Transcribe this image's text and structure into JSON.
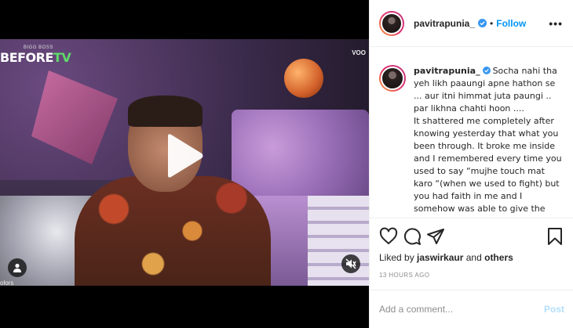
{
  "media": {
    "brand_small": "BIGG BOSS",
    "brand_before": "BEFORE",
    "brand_tv": "TV",
    "watermark_right": "VOO",
    "watermark_bottom": "olors"
  },
  "post_header": {
    "username": "pavitrapunia_",
    "separator": "•",
    "follow_label": "Follow",
    "more_label": "•••"
  },
  "caption": {
    "username": "pavitrapunia_",
    "lead": "Socha nahi tha yeh likh paaungi apne hathon se ... aur itni himmat juta paungi .. par likhna chahti hoon ....",
    "body": "It shattered me completely after knowing yesterday that what you been through. It broke me inside and I remembered every time you used to say “mujhe touch mat karo “(when we used to fight) but you had faith in me and I somehow was able to give the"
  },
  "likes": {
    "prefix": "Liked by ",
    "user": "jaswirkaur",
    "and": " and ",
    "others": "others"
  },
  "timestamp": "13 HOURS AGO",
  "comment": {
    "placeholder": "Add a comment...",
    "value": "",
    "post_label": "Post"
  },
  "colors": {
    "accent": "#0095f6",
    "verified": "#3897f0",
    "post_disabled": "#b2dffc"
  },
  "icons": [
    "play-icon",
    "user-tag-icon",
    "mute-icon",
    "verified-icon",
    "heart-icon",
    "comment-icon",
    "share-icon",
    "bookmark-icon",
    "more-icon"
  ]
}
